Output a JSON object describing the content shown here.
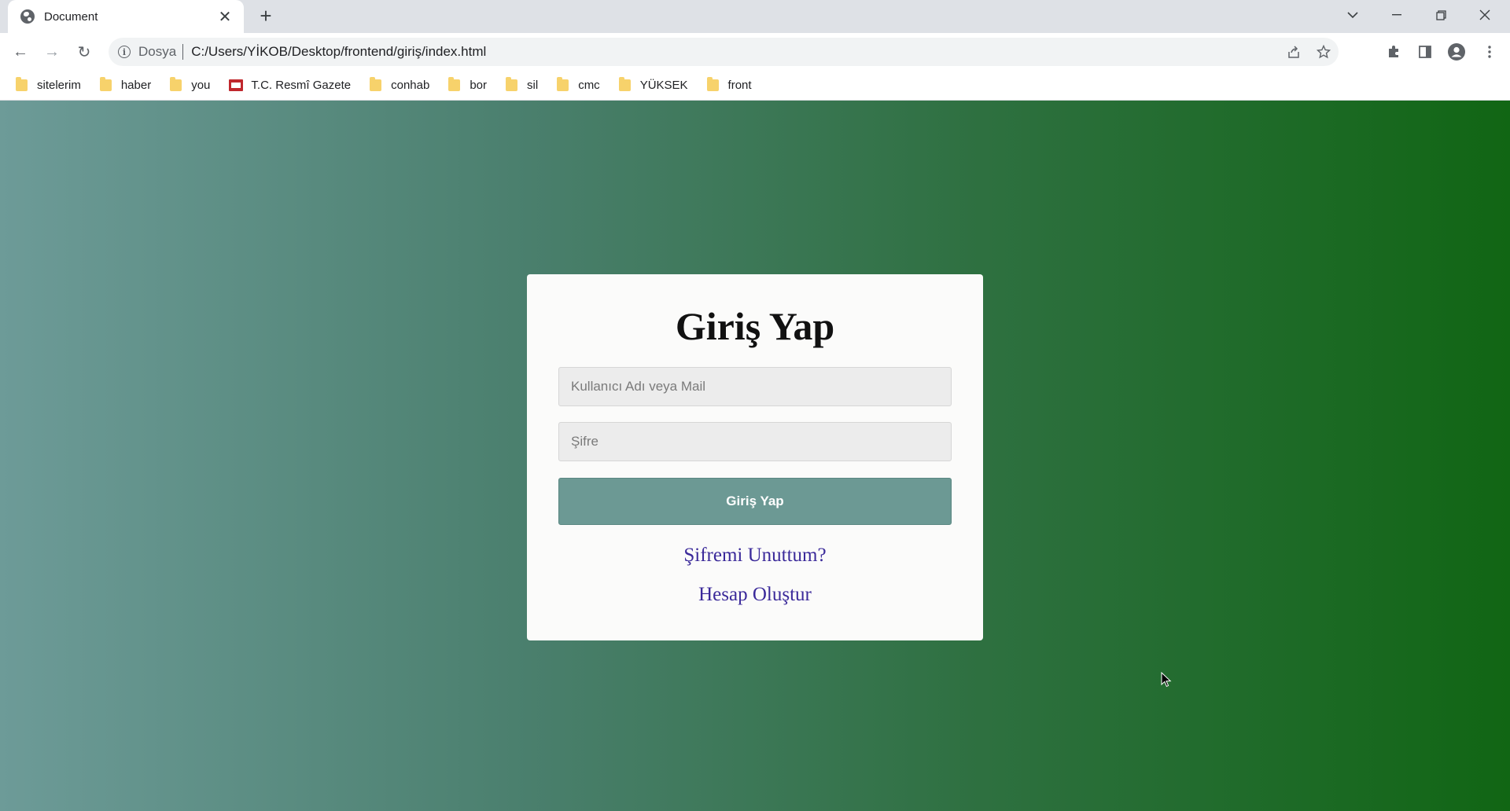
{
  "tab": {
    "title": "Document",
    "close": "✕",
    "new_tab": "+"
  },
  "window": {
    "minimize": "—",
    "restore": "❐",
    "close": "✕",
    "tab_search": "⌄"
  },
  "toolbar": {
    "back": "←",
    "forward": "→",
    "reload": "↻",
    "scheme_label": "Dosya",
    "url": "C:/Users/YİKOB/Desktop/frontend/giriş/index.html"
  },
  "bookmarks": [
    {
      "label": "sitelerim",
      "icon": "folder"
    },
    {
      "label": "haber",
      "icon": "folder"
    },
    {
      "label": "you",
      "icon": "folder"
    },
    {
      "label": "T.C. Resmî Gazete",
      "icon": "gazette"
    },
    {
      "label": "conhab",
      "icon": "folder"
    },
    {
      "label": "bor",
      "icon": "folder"
    },
    {
      "label": "sil",
      "icon": "folder"
    },
    {
      "label": "cmc",
      "icon": "folder"
    },
    {
      "label": "YÜKSEK",
      "icon": "folder"
    },
    {
      "label": "front",
      "icon": "folder"
    }
  ],
  "login": {
    "heading": "Giriş Yap",
    "username_placeholder": "Kullanıcı Adı veya Mail",
    "password_placeholder": "Şifre",
    "submit_label": "Giriş Yap",
    "forgot_link": "Şifremi Unuttum?",
    "create_link": "Hesap Oluştur"
  },
  "colors": {
    "gradient_start": "#6d9b98",
    "gradient_end": "#116614",
    "button": "#6c9994",
    "link": "#3b2a9a"
  }
}
